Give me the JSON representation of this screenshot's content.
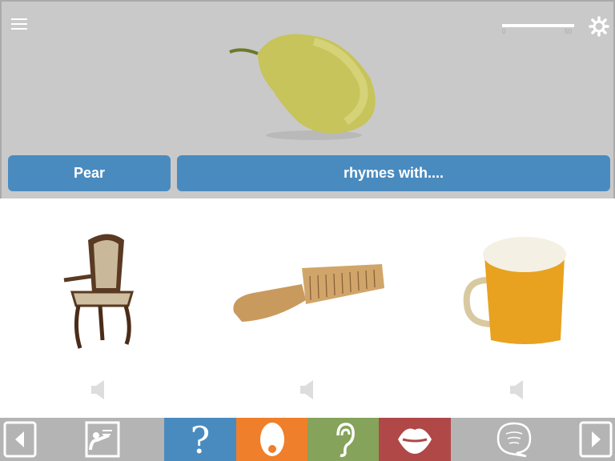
{
  "header": {
    "progress": {
      "value": 0,
      "min_label": "0",
      "max_label": "50"
    },
    "icons": [
      "menu-icon",
      "gear-icon"
    ]
  },
  "prompt": {
    "word": "Pear",
    "instruction": "rhymes with...."
  },
  "choices": [
    {
      "item": "chair"
    },
    {
      "item": "comb"
    },
    {
      "item": "beer"
    }
  ],
  "toolbar": {
    "items": [
      {
        "name": "previous",
        "color": "#b4b4b4"
      },
      {
        "name": "video-lesson",
        "color": "#b4b4b4"
      },
      {
        "name": "question",
        "color": "#4a8bbf"
      },
      {
        "name": "egg",
        "color": "#ef7f2a"
      },
      {
        "name": "ear",
        "color": "#85a35a"
      },
      {
        "name": "lips",
        "color": "#b04848"
      },
      {
        "name": "speech",
        "color": "#b4b4b4"
      },
      {
        "name": "next",
        "color": "#b4b4b4"
      }
    ]
  }
}
